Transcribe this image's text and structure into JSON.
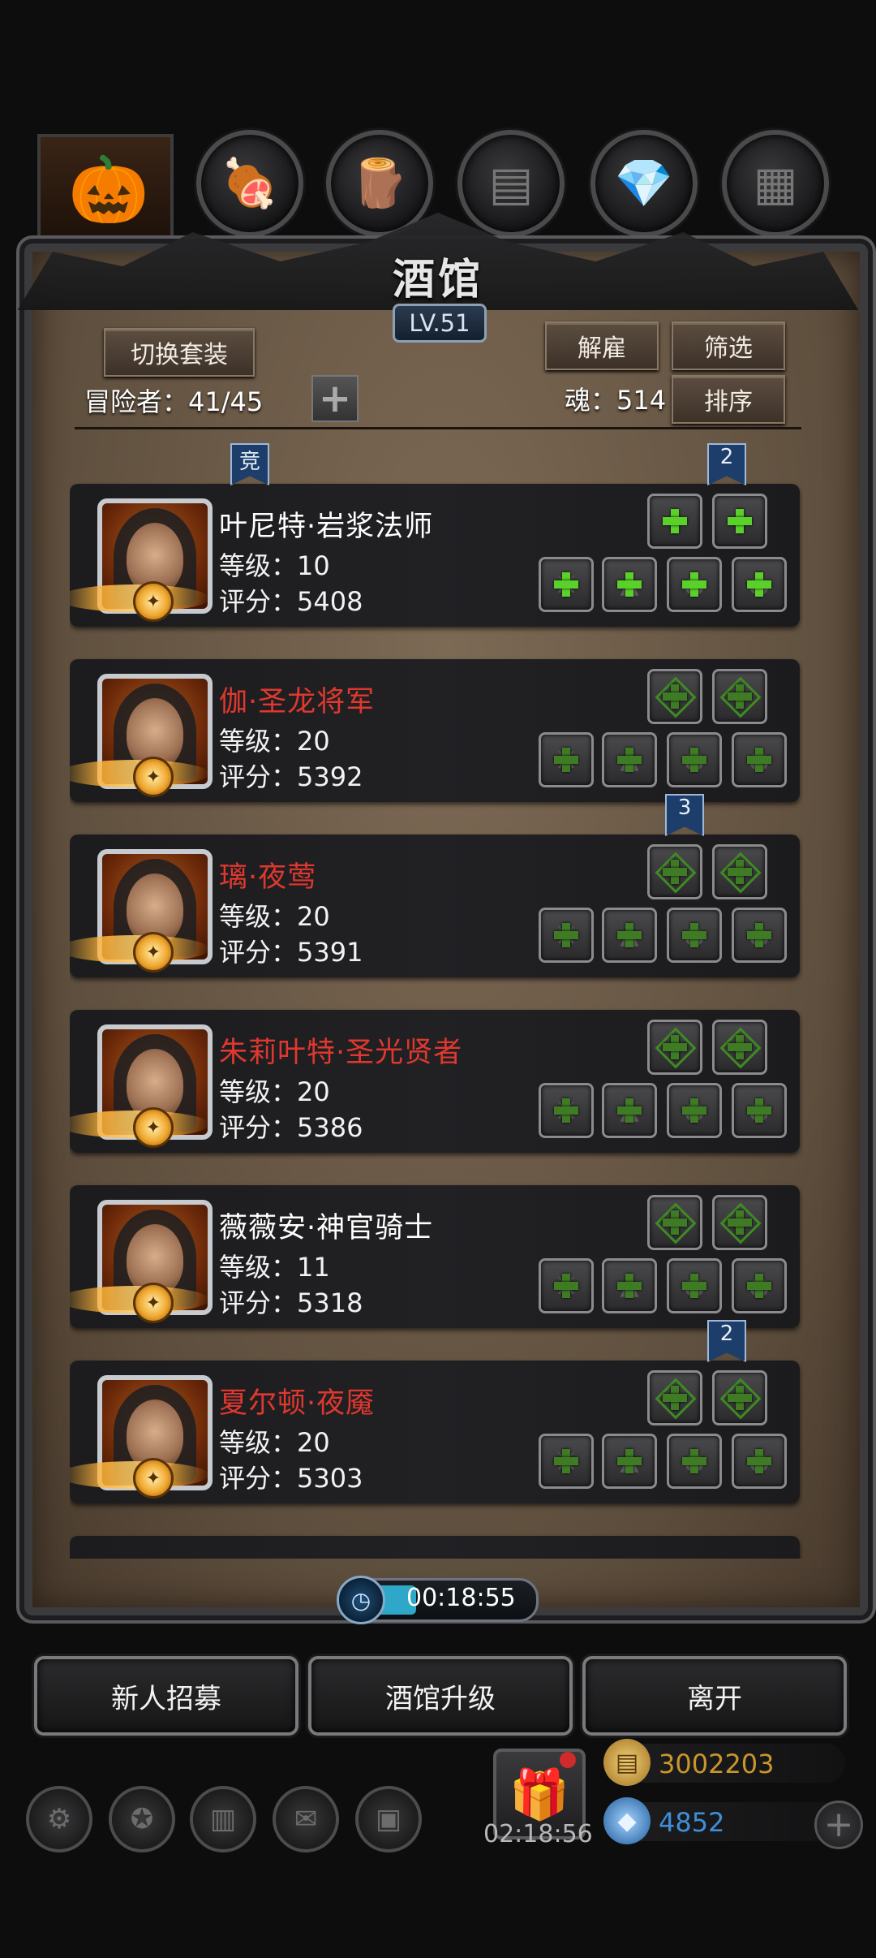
{
  "window": {
    "title": "酒馆",
    "level": "LV.51"
  },
  "top_resources": [
    {
      "name": "pumpkin-icon",
      "glyph": "🎃",
      "color": "#d36a1c"
    },
    {
      "name": "meat-icon",
      "glyph": "🍖",
      "color": "#8a4a22"
    },
    {
      "name": "wood-icon",
      "glyph": "🪵",
      "color": "#8a5a2a"
    },
    {
      "name": "iron-icon",
      "glyph": "⬛",
      "color": "#6a6a6a"
    },
    {
      "name": "crystal-icon",
      "glyph": "💎",
      "color": "#2f78c9"
    },
    {
      "name": "stone-icon",
      "glyph": "⬛",
      "color": "#555555"
    }
  ],
  "header": {
    "switch_outfit": "切换套装",
    "dismiss": "解雇",
    "filter": "筛选",
    "sort": "排序",
    "adventurers": "冒险者：41/45",
    "soul": "魂：514"
  },
  "heroes": [
    {
      "name": "叶尼特·岩浆法师",
      "color": "white",
      "level": "等级：10",
      "score": "评分：5408",
      "tag": "竞",
      "tag_pos": "left",
      "top_tag": "2",
      "style": "active"
    },
    {
      "name": "伽·圣龙将军",
      "color": "red",
      "level": "等级：20",
      "score": "评分：5392",
      "tag": "",
      "top_tag": "",
      "style": "cross"
    },
    {
      "name": "璃·夜莺",
      "color": "red",
      "level": "等级：20",
      "score": "评分：5391",
      "tag": "",
      "top_tag": "3",
      "style": "cross"
    },
    {
      "name": "朱莉叶特·圣光贤者",
      "color": "red",
      "level": "等级：20",
      "score": "评分：5386",
      "tag": "",
      "top_tag": "",
      "style": "cross"
    },
    {
      "name": "薇薇安·神官骑士",
      "color": "white",
      "level": "等级：11",
      "score": "评分：5318",
      "tag": "",
      "top_tag": "",
      "style": "cross"
    },
    {
      "name": "夏尔顿·夜魇",
      "color": "red",
      "level": "等级：20",
      "score": "评分：5303",
      "tag": "",
      "top_tag": "2",
      "style": "cross"
    }
  ],
  "timer": "00:18:55",
  "buttons": {
    "recruit": "新人招募",
    "upgrade": "酒馆升级",
    "leave": "离开"
  },
  "hud": {
    "gift_timer": "02:18:56",
    "gold": "3002203",
    "diamonds": "4852",
    "gold_color": "#c9962c",
    "diamond_color": "#3f8fd6"
  }
}
